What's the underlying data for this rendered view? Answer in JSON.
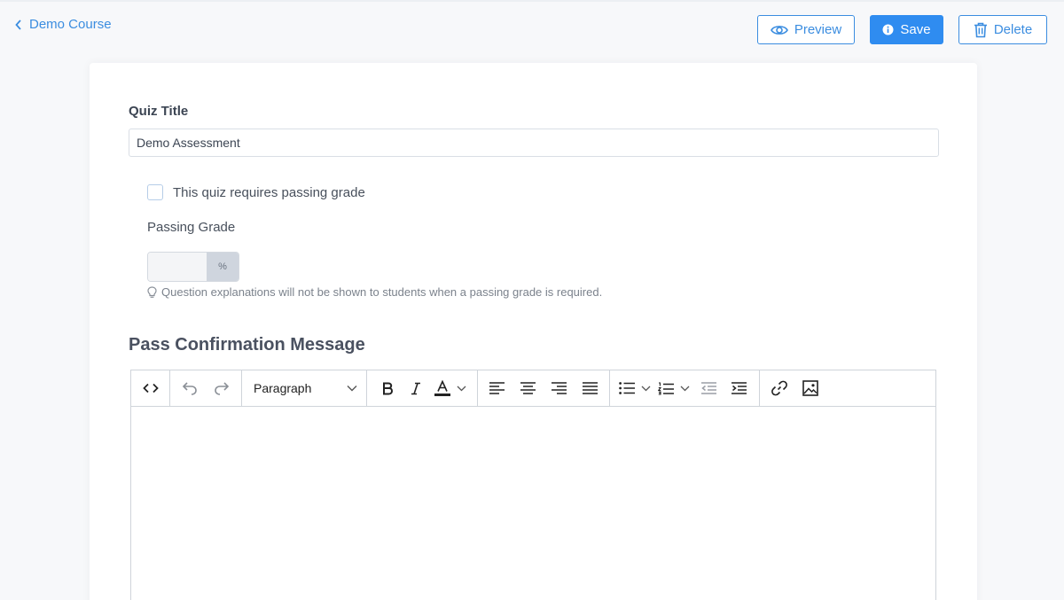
{
  "header": {
    "back_label": "Demo Course",
    "preview_label": "Preview",
    "save_label": "Save",
    "delete_label": "Delete"
  },
  "form": {
    "quiz_title_label": "Quiz Title",
    "quiz_title_value": "Demo Assessment",
    "passing_checkbox_label": "This quiz requires passing grade",
    "passing_checkbox_checked": false,
    "passing_grade_label": "Passing Grade",
    "passing_grade_value": "",
    "passing_grade_suffix": "%",
    "hint_text": "Question explanations will not be shown to students when a passing grade is required."
  },
  "section": {
    "title": "Pass Confirmation Message"
  },
  "editor": {
    "block_format": "Paragraph",
    "content": ""
  },
  "colors": {
    "accent": "#2f8cf0",
    "link": "#3b8de0",
    "background": "#f7f8fa"
  },
  "icons": {
    "back": "chevron-left-icon",
    "preview": "eye-icon",
    "save": "info-icon",
    "delete": "trash-icon",
    "hint": "lightbulb-icon"
  }
}
